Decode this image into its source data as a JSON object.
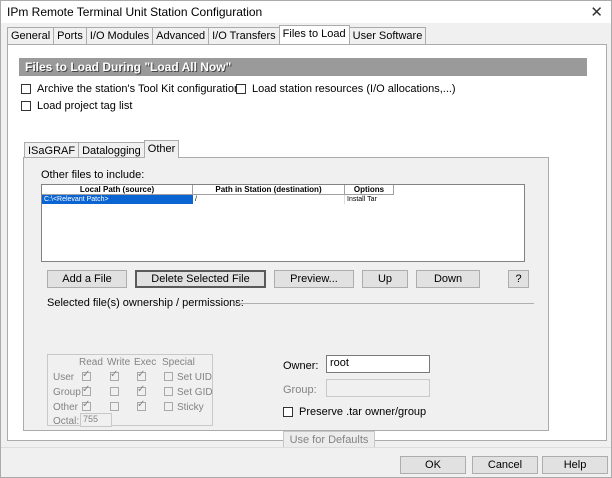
{
  "window": {
    "title": "IPm Remote Terminal Unit Station Configuration",
    "close_glyph": "✕"
  },
  "tabs": [
    {
      "label": "General"
    },
    {
      "label": "Ports"
    },
    {
      "label": "I/O Modules"
    },
    {
      "label": "Advanced"
    },
    {
      "label": "I/O Transfers"
    },
    {
      "label": "Files to Load",
      "active": true
    },
    {
      "label": "User Software"
    }
  ],
  "section": {
    "heading": "Files to Load During \"Load All Now\"",
    "archive_toolkit": {
      "label": "Archive the station's Tool Kit configuration",
      "checked": false
    },
    "load_resources": {
      "label": "Load station resources (I/O allocations,...)",
      "checked": false
    },
    "load_tag_list": {
      "label": "Load project tag list",
      "checked": false
    }
  },
  "subtabs": [
    {
      "label": "ISaGRAF"
    },
    {
      "label": "Datalogging"
    },
    {
      "label": "Other",
      "active": true
    }
  ],
  "other": {
    "list_label": "Other files to include:",
    "columns": [
      "Local Path (source)",
      "Path in Station (destination)",
      "Options"
    ],
    "rows": [
      {
        "source": "C:\\<Relevant Patch>",
        "destination": "/",
        "options": "Install Tar"
      }
    ],
    "buttons": {
      "add": "Add a File",
      "delete": "Delete Selected File",
      "preview": "Preview...",
      "up": "Up",
      "down": "Down",
      "help": "?"
    },
    "ownership_label": "Selected file(s) ownership / permissions:",
    "perm_headers": {
      "read": "Read",
      "write": "Write",
      "exec": "Exec",
      "special": "Special"
    },
    "perm_rows": {
      "user": "User",
      "group": "Group",
      "other": "Other"
    },
    "special": {
      "uid": "Set UID",
      "gid": "Set GID",
      "sticky": "Sticky"
    },
    "octal_label": "Octal:",
    "octal_value": "755",
    "owner_label": "Owner:",
    "owner_value": "root",
    "group_label": "Group:",
    "group_value": "",
    "preserve_label": "Preserve .tar owner/group",
    "defaults_button": "Use for Defaults"
  },
  "dialog_buttons": {
    "ok": "OK",
    "cancel": "Cancel",
    "help": "Help"
  }
}
